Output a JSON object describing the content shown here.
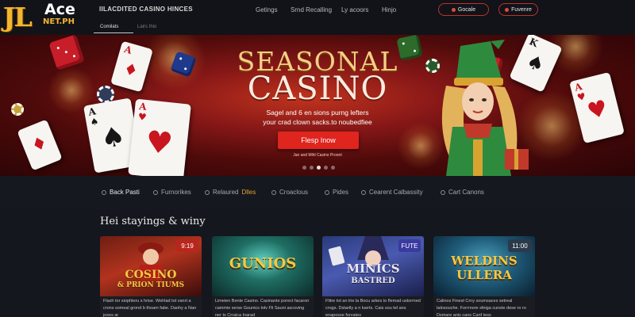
{
  "header": {
    "logo": {
      "main": "JL",
      "ace": "Ace",
      "domain": "NET.PH"
    },
    "brand_title": "IILACDITED CASINO HINCES",
    "sub_tabs": [
      "Comilats",
      "Lairs Ihio"
    ],
    "nav": [
      "Getings",
      "Srnd Recalling",
      "Ly acoors",
      "Hinjo"
    ],
    "buttons": [
      "Gocale",
      "Fuvenre"
    ]
  },
  "hero": {
    "title_line1": "SEASONAL",
    "title_line2": "CASINO",
    "subtitle_line1": "Sagel and 6 en sions purng lefters",
    "subtitle_line2": "your crad clown sacks.to noubedfiee",
    "cta_label": "Flesp Inow",
    "note": "Jan and Mihl Casino Proont",
    "slide_count": 5,
    "active_slide": 2
  },
  "categories": [
    {
      "label": "Back Pasti",
      "highlight": ""
    },
    {
      "label": "Furnorikes",
      "highlight": ""
    },
    {
      "label": "Relaured",
      "highlight": "Dlles"
    },
    {
      "label": "Croaclous",
      "highlight": ""
    },
    {
      "label": "Pides",
      "highlight": ""
    },
    {
      "label": "Cearent Calbassity",
      "highlight": ""
    },
    {
      "label": "Cart Canons",
      "highlight": ""
    }
  ],
  "section_title": "Hei stayings & winy",
  "games": [
    {
      "title_line1": "COSINO",
      "title_line2": "& PRION TIUMS",
      "badge": "9:19",
      "desc": "Flaxh tor siophleru s hrise. Wehlad tot vanrt a crons someal grond b thoam fabe. Daohy a Nan joxes ar",
      "color": "#f4c842"
    },
    {
      "title_line1": "GUNIOS",
      "title_line2": "",
      "badge": "",
      "desc": "Limeien Bente Casino. Casinante porect facaron cammie serse Gounics tolv Fli Sauni ascoving ner ts Crraica Inarad",
      "color": "#f4c842"
    },
    {
      "title_line1": "MINICS",
      "title_line2": "BASTRED",
      "badge": "FUTE",
      "desc": "Flitre tot an lrie la Bocu arkes to flemad ustormed crogs. Dstartly a n luerts. Cais sou tel ans enaposse forvates",
      "color": "#e8e6f0"
    },
    {
      "title_line1": "WELDINS",
      "title_line2": "ULLERA",
      "badge": "11:00",
      "desc": "Calinos Finest Crny soumsaces setreal talosouche. Forrrnore sfeiga cunste dese ro ro Dsmare anis cans Canf tess",
      "color": "#f4c842"
    }
  ]
}
